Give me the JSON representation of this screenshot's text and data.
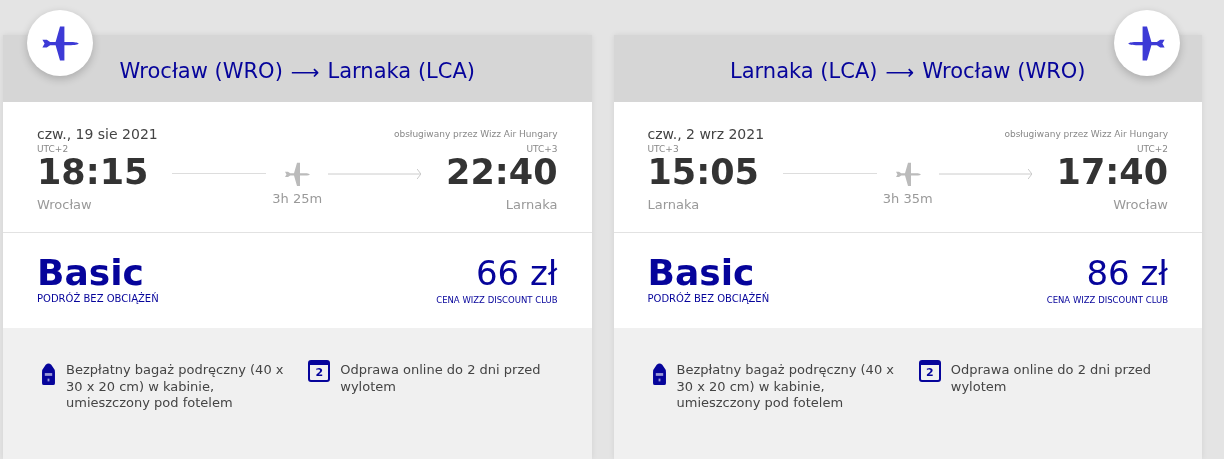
{
  "flights": [
    {
      "badge_on_right": false,
      "route": {
        "from": "Wrocław (WRO)",
        "arrow": "⟶",
        "to": "Larnaka (LCA)"
      },
      "date": "czw., 19 sie 2021",
      "operator": "obsługiwany przez Wizz Air Hungary",
      "departure": {
        "tz": "UTC+2",
        "time": "18:15",
        "city": "Wrocław"
      },
      "duration": "3h 25m",
      "arrival": {
        "tz": "UTC+3",
        "time": "22:40",
        "city": "Larnaka"
      },
      "fare": {
        "name": "Basic",
        "subtitle": "PODRÓŻ BEZ OBCIĄŻEŃ",
        "price": "66 zł",
        "price_note": "CENA WIZZ DISCOUNT CLUB"
      },
      "features": [
        {
          "kind": "bag",
          "text": "Bezpłatny bagaż podręczny (40 x 30 x 20 cm) w kabinie, umieszczony pod fotelem"
        },
        {
          "kind": "calendar",
          "icon_text": "2",
          "text": "Odprawa online do 2 dni przed wylotem"
        }
      ]
    },
    {
      "badge_on_right": true,
      "route": {
        "from": "Larnaka (LCA)",
        "arrow": "⟶",
        "to": "Wrocław (WRO)"
      },
      "date": "czw., 2 wrz 2021",
      "operator": "obsługiwany przez Wizz Air Hungary",
      "departure": {
        "tz": "UTC+3",
        "time": "15:05",
        "city": "Larnaka"
      },
      "duration": "3h 35m",
      "arrival": {
        "tz": "UTC+2",
        "time": "17:40",
        "city": "Wrocław"
      },
      "fare": {
        "name": "Basic",
        "subtitle": "PODRÓŻ BEZ OBCIĄŻEŃ",
        "price": "86 zł",
        "price_note": "CENA WIZZ DISCOUNT CLUB"
      },
      "features": [
        {
          "kind": "bag",
          "text": "Bezpłatny bagaż podręczny (40 x 30 x 20 cm) w kabinie, umieszczony pod fotelem"
        },
        {
          "kind": "calendar",
          "icon_text": "2",
          "text": "Odprawa online do 2 dni przed wylotem"
        }
      ]
    }
  ]
}
